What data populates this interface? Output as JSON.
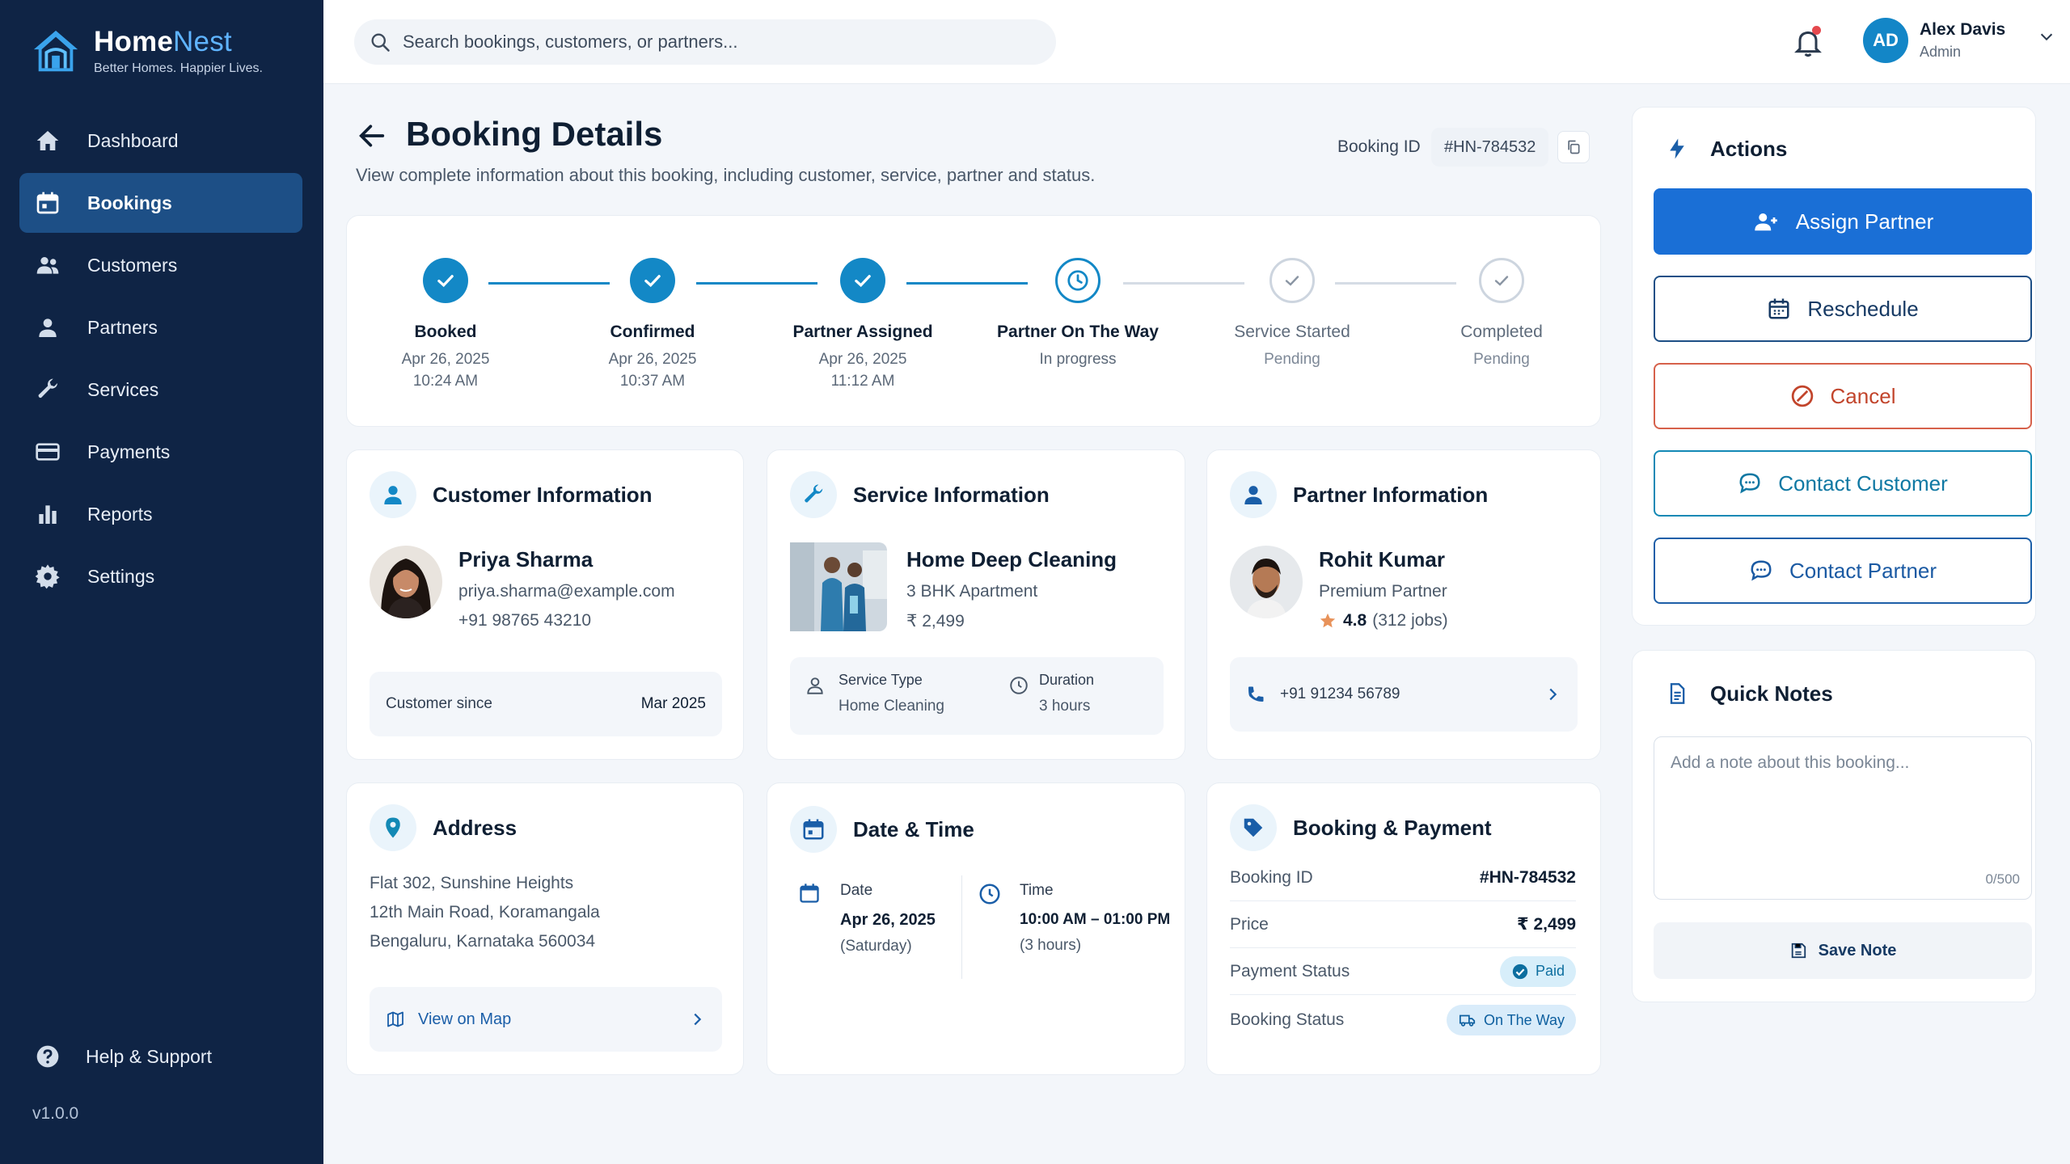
{
  "brand": {
    "name_main": "Home",
    "name_accent": "Nest",
    "tagline": "Better Homes. Happier Lives."
  },
  "sidebar": {
    "items": [
      {
        "label": "Dashboard",
        "icon": "home-icon",
        "active": false
      },
      {
        "label": "Bookings",
        "icon": "calendar-icon",
        "active": true
      },
      {
        "label": "Customers",
        "icon": "users-icon",
        "active": false
      },
      {
        "label": "Partners",
        "icon": "user-icon",
        "active": false
      },
      {
        "label": "Services",
        "icon": "wrench-icon",
        "active": false
      },
      {
        "label": "Payments",
        "icon": "credit-card-icon",
        "active": false
      },
      {
        "label": "Reports",
        "icon": "bar-chart-icon",
        "active": false
      },
      {
        "label": "Settings",
        "icon": "gear-icon",
        "active": false
      }
    ],
    "help_label": "Help & Support",
    "version": "v1.0.0"
  },
  "topbar": {
    "search_placeholder": "Search bookings, customers, or partners...",
    "user": {
      "initials": "AD",
      "name": "Alex Davis",
      "role": "Admin"
    }
  },
  "header": {
    "title": "Booking Details",
    "subtitle": "View complete information about this booking, including customer, service, partner and status.",
    "booking_id_label": "Booking ID",
    "booking_id": "#HN-784532"
  },
  "progress": {
    "steps": [
      {
        "title": "Booked",
        "date": "Apr 26, 2025",
        "time": "10:24 AM",
        "state": "done"
      },
      {
        "title": "Confirmed",
        "date": "Apr 26, 2025",
        "time": "10:37 AM",
        "state": "done"
      },
      {
        "title": "Partner Assigned",
        "date": "Apr 26, 2025",
        "time": "11:12 AM",
        "state": "done"
      },
      {
        "title": "Partner On The Way",
        "date": "In progress",
        "time": "",
        "state": "current"
      },
      {
        "title": "Service Started",
        "date": "Pending",
        "time": "",
        "state": "pending"
      },
      {
        "title": "Completed",
        "date": "Pending",
        "time": "",
        "state": "pending"
      }
    ]
  },
  "customer": {
    "title": "Customer Information",
    "name": "Priya Sharma",
    "email": "priya.sharma@example.com",
    "phone": "+91 98765 43210",
    "since_label": "Customer since",
    "since_value": "Mar 2025"
  },
  "service": {
    "title": "Service Information",
    "name": "Home Deep Cleaning",
    "detail": "3 BHK Apartment",
    "price": "₹ 2,499",
    "type_label": "Service Type",
    "type_value": "Home Cleaning",
    "duration_label": "Duration",
    "duration_value": "3 hours"
  },
  "partner": {
    "title": "Partner Information",
    "name": "Rohit Kumar",
    "tier": "Premium Partner",
    "rating": "4.8",
    "jobs": "(312 jobs)",
    "phone": "+91 91234 56789"
  },
  "address": {
    "title": "Address",
    "line1": "Flat 302, Sunshine Heights",
    "line2": "12th Main Road, Koramangala",
    "line3": "Bengaluru, Karnataka 560034",
    "map_label": "View on Map"
  },
  "datetime": {
    "title": "Date & Time",
    "date_label": "Date",
    "date_value": "Apr 26, 2025",
    "date_day": "(Saturday)",
    "time_label": "Time",
    "time_value": "10:00 AM – 01:00 PM",
    "time_duration": "(3 hours)"
  },
  "payment": {
    "title": "Booking & Payment",
    "rows": {
      "booking_id_label": "Booking ID",
      "booking_id": "#HN-784532",
      "price_label": "Price",
      "price": "₹ 2,499",
      "payment_status_label": "Payment Status",
      "payment_status": "Paid",
      "booking_status_label": "Booking Status",
      "booking_status": "On The Way"
    }
  },
  "actions": {
    "title": "Actions",
    "assign": "Assign Partner",
    "reschedule": "Reschedule",
    "cancel": "Cancel",
    "contact_customer": "Contact Customer",
    "contact_partner": "Contact Partner"
  },
  "notes": {
    "title": "Quick Notes",
    "placeholder": "Add a note about this booking...",
    "count": "0/500",
    "save": "Save Note"
  },
  "colors": {
    "sidebar": "#0f2445",
    "active_nav": "#1d4f86",
    "accent": "#1388c6",
    "primary_button": "#1a6fd6",
    "cancel": "#d6614b"
  }
}
